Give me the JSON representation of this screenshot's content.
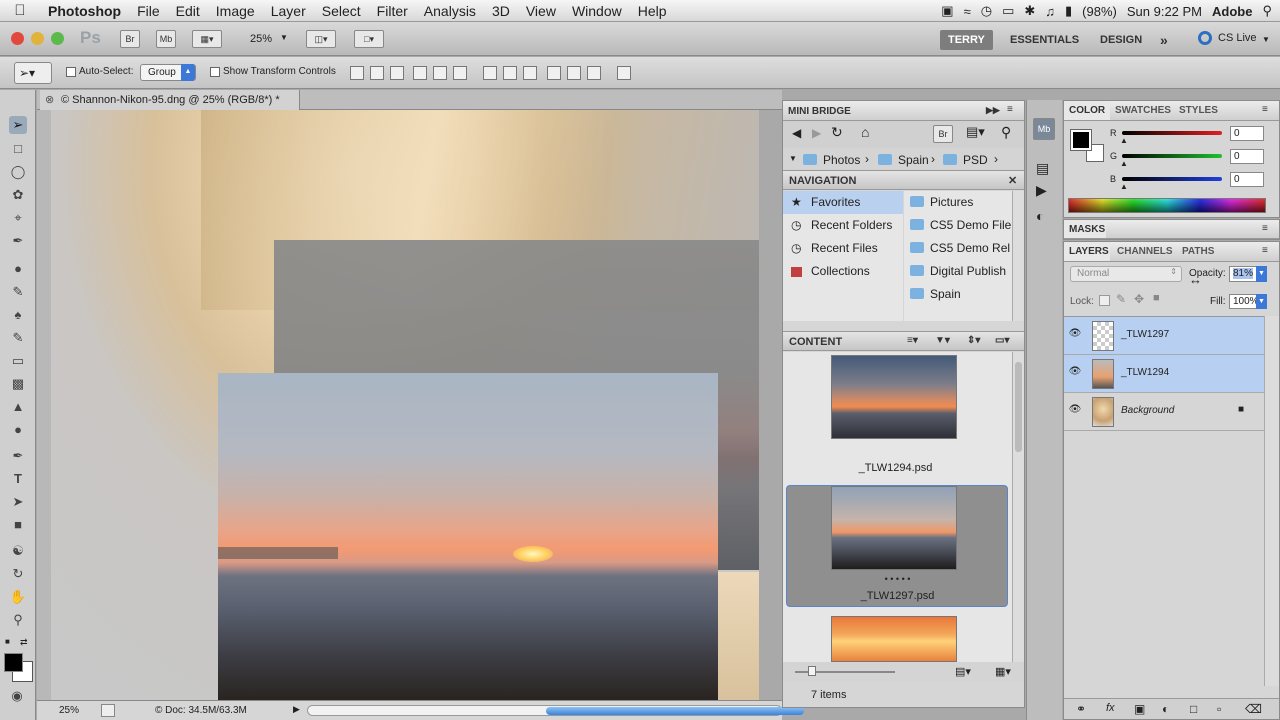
{
  "menubar": {
    "app": "Photoshop",
    "items": [
      "File",
      "Edit",
      "Image",
      "Layer",
      "Select",
      "Filter",
      "Analysis",
      "3D",
      "View",
      "Window",
      "Help"
    ],
    "battery": "(98%)",
    "clock": "Sun 9:22 PM",
    "user": "Adobe"
  },
  "appbar": {
    "ps_logo": "Ps",
    "br": "Br",
    "mb": "Mb",
    "zoom": "25%",
    "workspaces": [
      "TERRY",
      "ESSENTIALS",
      "DESIGN"
    ],
    "more": "»",
    "cslive": "CS Live"
  },
  "options": {
    "auto_select_label": "Auto-Select:",
    "auto_select_value": "Group",
    "show_transform_label": "Show Transform Controls"
  },
  "document": {
    "tab_title": "© Shannon-Nikon-95.dng @ 25% (RGB/8*) *",
    "status_zoom": "25%",
    "status_doc": "© Doc: 34.5M/63.3M"
  },
  "mini_bridge": {
    "title": "MINI BRIDGE",
    "br": "Br",
    "path": [
      "Photos",
      "Spain",
      "PSD"
    ],
    "navigation_title": "NAVIGATION",
    "nav_left": [
      "Favorites",
      "Recent Folders",
      "Recent Files",
      "Collections"
    ],
    "nav_right": [
      "Pictures",
      "CS5 Demo File",
      "CS5 Demo Rel",
      "Digital Publish",
      "Spain"
    ],
    "content_title": "CONTENT",
    "items": [
      {
        "name": "_TLW1294.psd"
      },
      {
        "name": "_TLW1297.psd",
        "stars": "• • • • •"
      }
    ],
    "count": "7 items"
  },
  "color_panel": {
    "tabs": [
      "COLOR",
      "SWATCHES",
      "STYLES"
    ],
    "channels": [
      {
        "label": "R",
        "value": "0",
        "color": "#cc2020"
      },
      {
        "label": "G",
        "value": "0",
        "color": "#20aa30"
      },
      {
        "label": "B",
        "value": "0",
        "color": "#2040cc"
      }
    ]
  },
  "masks_panel": {
    "title": "MASKS"
  },
  "layers_panel": {
    "tabs": [
      "LAYERS",
      "CHANNELS",
      "PATHS"
    ],
    "blend_mode": "Normal",
    "opacity_label": "Opacity:",
    "opacity_value": "81%",
    "lock_label": "Lock:",
    "fill_label": "Fill:",
    "fill_value": "100%",
    "layers": [
      {
        "name": "_TLW1297",
        "selected": true
      },
      {
        "name": "_TLW1294",
        "selected": true
      },
      {
        "name": "Background",
        "selected": false,
        "locked": true
      }
    ]
  }
}
